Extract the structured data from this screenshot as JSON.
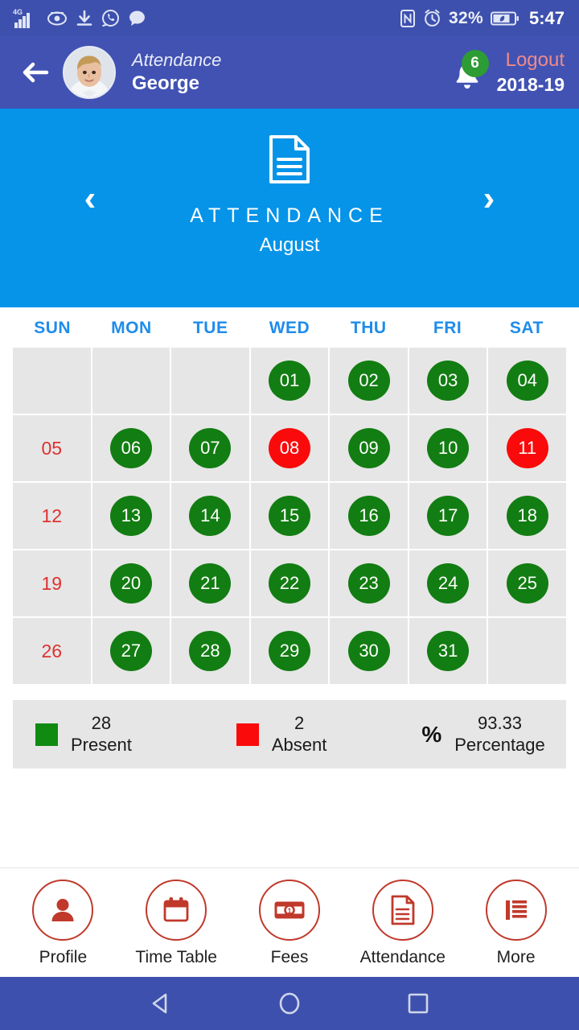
{
  "status_bar": {
    "network": "4G",
    "icons": [
      "signal-4g-icon",
      "eye-icon",
      "download-icon",
      "whatsapp-icon",
      "message-icon",
      "nfc-icon",
      "alarm-icon"
    ],
    "battery_percent": "32%",
    "time": "5:47"
  },
  "header": {
    "back_label": "Back",
    "subtitle": "Attendance",
    "student_name": "George",
    "notification_count": "6",
    "logout_label": "Logout",
    "academic_year": "2018-19"
  },
  "banner": {
    "title": "ATTENDANCE",
    "month": "August",
    "prev_label": "‹",
    "next_label": "›"
  },
  "calendar": {
    "day_headers": [
      "SUN",
      "MON",
      "TUE",
      "WED",
      "THU",
      "FRI",
      "SAT"
    ],
    "weeks": [
      [
        {
          "day": "",
          "state": "blank"
        },
        {
          "day": "",
          "state": "blank"
        },
        {
          "day": "",
          "state": "blank"
        },
        {
          "day": "01",
          "state": "present"
        },
        {
          "day": "02",
          "state": "present"
        },
        {
          "day": "03",
          "state": "present"
        },
        {
          "day": "04",
          "state": "present"
        }
      ],
      [
        {
          "day": "05",
          "state": "sunday"
        },
        {
          "day": "06",
          "state": "present"
        },
        {
          "day": "07",
          "state": "present"
        },
        {
          "day": "08",
          "state": "absent"
        },
        {
          "day": "09",
          "state": "present"
        },
        {
          "day": "10",
          "state": "present"
        },
        {
          "day": "11",
          "state": "absent"
        }
      ],
      [
        {
          "day": "12",
          "state": "sunday"
        },
        {
          "day": "13",
          "state": "present"
        },
        {
          "day": "14",
          "state": "present"
        },
        {
          "day": "15",
          "state": "present"
        },
        {
          "day": "16",
          "state": "present"
        },
        {
          "day": "17",
          "state": "present"
        },
        {
          "day": "18",
          "state": "present"
        }
      ],
      [
        {
          "day": "19",
          "state": "sunday"
        },
        {
          "day": "20",
          "state": "present"
        },
        {
          "day": "21",
          "state": "present"
        },
        {
          "day": "22",
          "state": "present"
        },
        {
          "day": "23",
          "state": "present"
        },
        {
          "day": "24",
          "state": "present"
        },
        {
          "day": "25",
          "state": "present"
        }
      ],
      [
        {
          "day": "26",
          "state": "sunday"
        },
        {
          "day": "27",
          "state": "present"
        },
        {
          "day": "28",
          "state": "present"
        },
        {
          "day": "29",
          "state": "present"
        },
        {
          "day": "30",
          "state": "present"
        },
        {
          "day": "31",
          "state": "present"
        },
        {
          "day": "",
          "state": "blank"
        }
      ]
    ]
  },
  "summary": {
    "present_count": "28",
    "present_label": "Present",
    "absent_count": "2",
    "absent_label": "Absent",
    "percent_sign": "%",
    "percentage_value": "93.33",
    "percentage_label": "Percentage"
  },
  "bottom_nav": {
    "items": [
      {
        "label": "Profile",
        "icon": "person-icon"
      },
      {
        "label": "Time Table",
        "icon": "calendar-icon"
      },
      {
        "label": "Fees",
        "icon": "banknote-icon"
      },
      {
        "label": "Attendance",
        "icon": "document-icon"
      },
      {
        "label": "More",
        "icon": "list-icon"
      }
    ]
  },
  "android_nav": {
    "back": "back-triangle-icon",
    "home": "home-circle-icon",
    "recents": "recents-square-icon"
  },
  "colors": {
    "status_bar": "#3e50ad",
    "app_bar": "#4152b3",
    "banner": "#0594e8",
    "present_green": "#127d12",
    "absent_red": "#fa0a0a",
    "sunday_red": "#e03131",
    "day_header_blue": "#1f8ceb",
    "cell_gray": "#e6e6e6",
    "nav_accent": "#c0392b",
    "logout_text": "#f08a86",
    "badge_green": "#2e9c34"
  }
}
